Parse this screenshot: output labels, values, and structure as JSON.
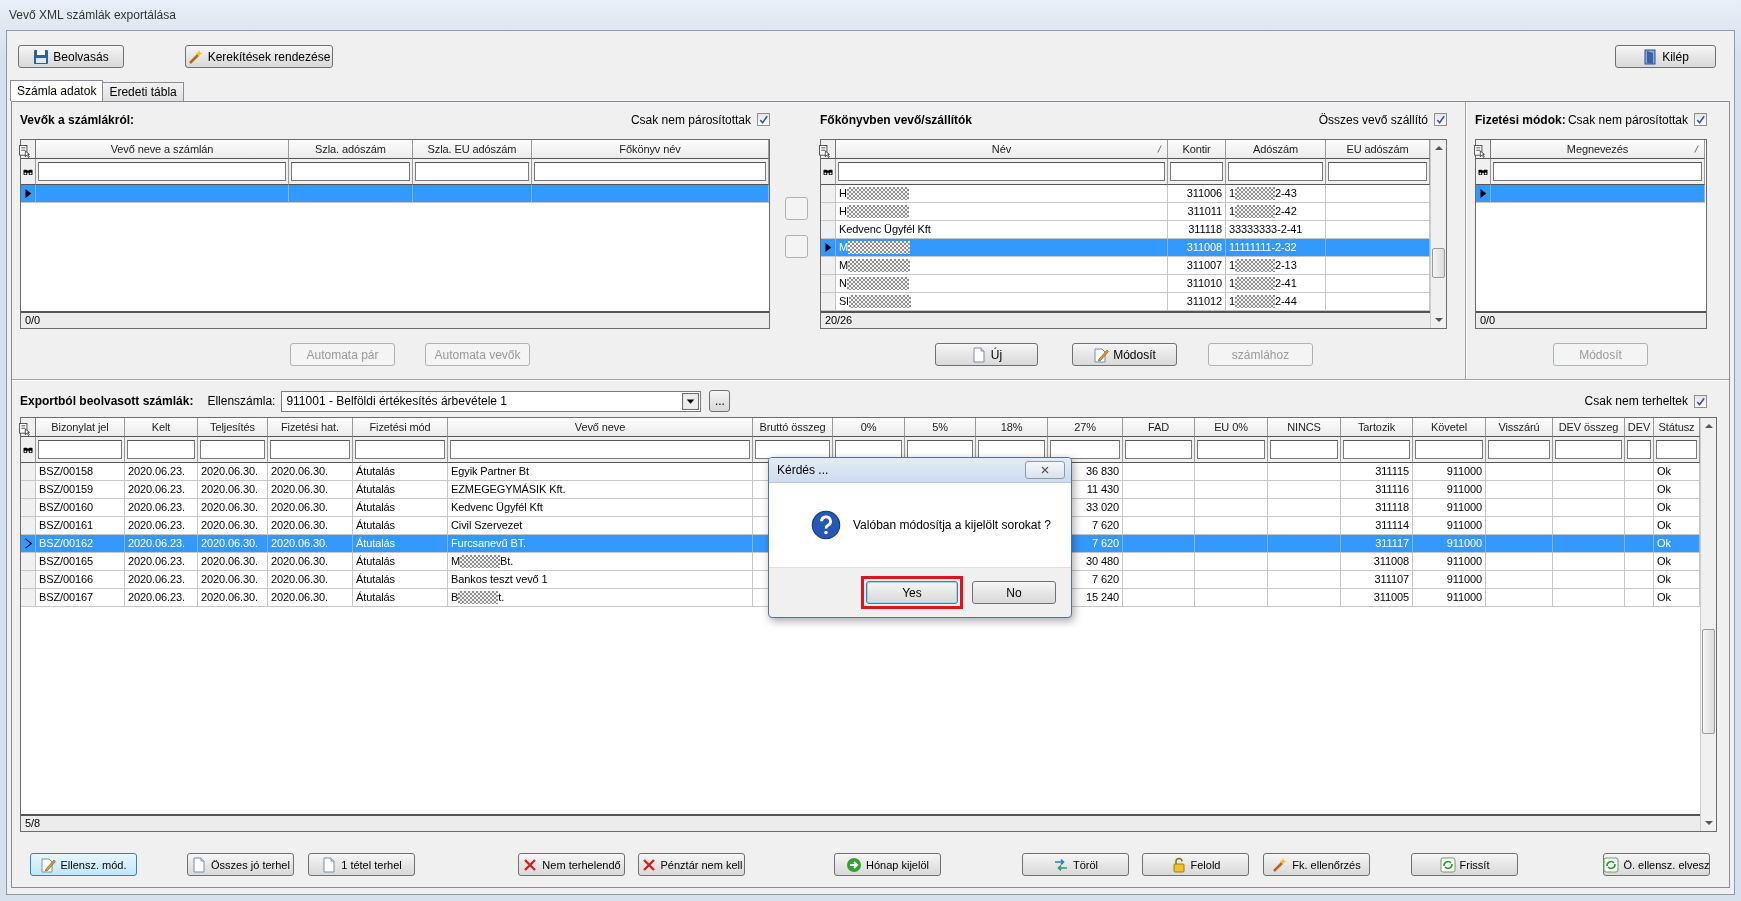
{
  "window": {
    "title": "Vevő XML számlák exportálása"
  },
  "toolbar": [
    {
      "label": "Beolvasás"
    },
    {
      "label": "Kerekítések rendezése"
    },
    {
      "label": "Kilép"
    }
  ],
  "tabs": [
    {
      "label": "Számla adatok",
      "selected": true
    },
    {
      "label": "Eredeti tábla",
      "selected": false
    }
  ],
  "customers_panel": {
    "title": "Vevők a számlákról:",
    "filter": {
      "label": "Csak nem párosítottak",
      "checked": true
    },
    "grid": {
      "columns": [
        "Vevő neve a számlán",
        "Szla. adószám",
        "Szla. EU adószám",
        "Főkönyv név"
      ],
      "rows": [
        {
          "cells": [
            null,
            null,
            null,
            null
          ],
          "selected": true
        }
      ],
      "footer": "0/0"
    },
    "buttons": [
      {
        "label": "Automata pár",
        "disabled": true
      },
      {
        "label": "Automata vevők",
        "disabled": true
      }
    ]
  },
  "transfer_buttons": [
    {
      "disabled": true
    },
    {
      "disabled": true
    }
  ],
  "ledger_panel": {
    "title": "Főkönyvben vevő/szállítók",
    "filter": {
      "label": "Összes vevő szállító",
      "checked": true
    },
    "grid": {
      "columns": [
        {
          "label": "Név",
          "sorted": true
        },
        {
          "label": "Kontir",
          "sorted": false
        },
        {
          "label": "Adószám",
          "sorted": false
        },
        {
          "label": "EU adószám",
          "sorted": false
        }
      ],
      "rows": [
        {
          "cells": [
            [
              "H"
            ],
            "311006",
            [
              "1",
              "2-43"
            ],
            null
          ],
          "selected": false
        },
        {
          "cells": [
            [
              "H"
            ],
            "311011",
            [
              "1",
              "2-42"
            ],
            null
          ],
          "selected": false
        },
        {
          "cells": [
            "Kedvenc Ügyfél Kft",
            "311118",
            "33333333-2-41",
            null
          ],
          "selected": false
        },
        {
          "cells": [
            [
              "M"
            ],
            "311008",
            "11111111-2-32",
            null
          ],
          "selected": true
        },
        {
          "cells": [
            [
              "M"
            ],
            "311007",
            [
              "1",
              "2-13"
            ],
            null
          ],
          "selected": false
        },
        {
          "cells": [
            [
              "N"
            ],
            "311010",
            [
              "1",
              "2-41"
            ],
            null
          ],
          "selected": false
        },
        {
          "cells": [
            [
              "Sl"
            ],
            "311012",
            [
              "1",
              "2-44"
            ],
            null
          ],
          "selected": false
        }
      ],
      "footer": "20/26"
    },
    "buttons": [
      {
        "label": "Új",
        "disabled": false
      },
      {
        "label": "Módosít",
        "disabled": false
      },
      {
        "label": "számlához",
        "disabled": true
      }
    ]
  },
  "payment_panel": {
    "title": "Fizetési módok:",
    "filter": {
      "label": "Csak nem párosítottak",
      "checked": true
    },
    "grid": {
      "columns": [
        {
          "label": "Megnevezés",
          "sorted": true
        }
      ],
      "rows": [
        {
          "cells": [
            null
          ],
          "selected": true
        }
      ],
      "footer": "0/0"
    },
    "buttons": [
      {
        "label": "Módosít",
        "disabled": true
      }
    ]
  },
  "invoices_panel": {
    "title": "Exportból beolvasott számlák:",
    "account": {
      "label": "Ellenszámla:",
      "value": "911001 - Belföldi értékesítés árbevétele 1"
    },
    "browse_button": "...",
    "filter": {
      "label": "Csak nem terheltek",
      "checked": true
    },
    "grid": {
      "columns": [
        "Bizonylat jel",
        "Kelt",
        "Teljesítés",
        "Fizetési hat.",
        "Fizetési mód",
        "Vevő neve",
        "Bruttó összeg",
        "0%",
        "5%",
        "18%",
        "27%",
        "FAD",
        "EU 0%",
        "NINCS",
        "Tartozik",
        "Követel",
        "Visszárú",
        "DEV összeg",
        "DEV",
        "Státusz"
      ],
      "rows": [
        {
          "cells": [
            "BSZ/00158",
            "2020.06.23.",
            "2020.06.30.",
            "2020.06.30.",
            "Átutalás",
            "Egyik Partner Bt",
            null,
            null,
            null,
            null,
            "36 830",
            null,
            null,
            null,
            "311115",
            "911000",
            null,
            null,
            null,
            "Ok"
          ],
          "selected": false
        },
        {
          "cells": [
            "BSZ/00159",
            "2020.06.23.",
            "2020.06.30.",
            "2020.06.30.",
            "Átutalás",
            "EZMEGEGYMÁSIK Kft.",
            null,
            null,
            null,
            null,
            "11 430",
            null,
            null,
            null,
            "311116",
            "911000",
            null,
            null,
            null,
            "Ok"
          ],
          "selected": false
        },
        {
          "cells": [
            "BSZ/00160",
            "2020.06.23.",
            "2020.06.30.",
            "2020.06.30.",
            "Átutalás",
            "Kedvenc Ügyfél Kft",
            null,
            null,
            null,
            null,
            "33 020",
            null,
            null,
            null,
            "311118",
            "911000",
            null,
            null,
            null,
            "Ok"
          ],
          "selected": false
        },
        {
          "cells": [
            "BSZ/00161",
            "2020.06.23.",
            "2020.06.30.",
            "2020.06.30.",
            "Átutalás",
            "Civil Szervezet",
            null,
            null,
            null,
            null,
            "7 620",
            null,
            null,
            null,
            "311114",
            "911000",
            null,
            null,
            null,
            "Ok"
          ],
          "selected": false
        },
        {
          "cells": [
            "BSZ/00162",
            "2020.06.23.",
            "2020.06.30.",
            "2020.06.30.",
            "Átutalás",
            "Furcsanevű BT.",
            null,
            null,
            null,
            null,
            "7 620",
            null,
            null,
            null,
            "311117",
            "911000",
            null,
            null,
            null,
            "Ok"
          ],
          "selected": true
        },
        {
          "cells": [
            "BSZ/00165",
            "2020.06.23.",
            "2020.06.30.",
            "2020.06.30.",
            "Átutalás",
            [
              "M",
              "Bt."
            ],
            null,
            null,
            null,
            null,
            "30 480",
            null,
            null,
            null,
            "311008",
            "911000",
            null,
            null,
            null,
            "Ok"
          ],
          "selected": false
        },
        {
          "cells": [
            "BSZ/00166",
            "2020.06.23.",
            "2020.06.30.",
            "2020.06.30.",
            "Átutalás",
            "Bankos teszt vevő 1",
            null,
            null,
            null,
            null,
            "7 620",
            null,
            null,
            null,
            "311107",
            "911000",
            null,
            null,
            null,
            "Ok"
          ],
          "selected": false
        },
        {
          "cells": [
            "BSZ/00167",
            "2020.06.23.",
            "2020.06.30.",
            "2020.06.30.",
            "Átutalás",
            [
              "B",
              "t."
            ],
            null,
            null,
            null,
            null,
            "15 240",
            null,
            null,
            null,
            "311005",
            "911000",
            null,
            null,
            null,
            "Ok"
          ],
          "selected": false
        }
      ],
      "footer": "5/8"
    }
  },
  "bottom_buttons": [
    {
      "label": "Ellensz. mód.",
      "focused": true
    },
    {
      "label": "Összes jó terhel",
      "focused": false
    },
    {
      "label": "1 tétel terhel",
      "focused": false
    },
    {
      "label": "Nem terhelendő",
      "focused": false
    },
    {
      "label": "Pénztár nem kell",
      "focused": false
    },
    {
      "label": "Hónap kijelöl",
      "focused": false
    },
    {
      "label": "Töröl",
      "focused": false
    },
    {
      "label": "Felold",
      "focused": false
    },
    {
      "label": "Fk. ellenőrzés",
      "focused": false
    },
    {
      "label": "Frissít",
      "focused": false
    },
    {
      "label": "Ö. ellensz. elvesz",
      "focused": false
    }
  ],
  "dialog": {
    "title": "Kérdés ...",
    "message": "Valóban módosítja a kijelölt sorokat ?",
    "buttons": [
      {
        "label": "Yes",
        "highlighted": true
      },
      {
        "label": "No",
        "highlighted": false
      }
    ]
  }
}
